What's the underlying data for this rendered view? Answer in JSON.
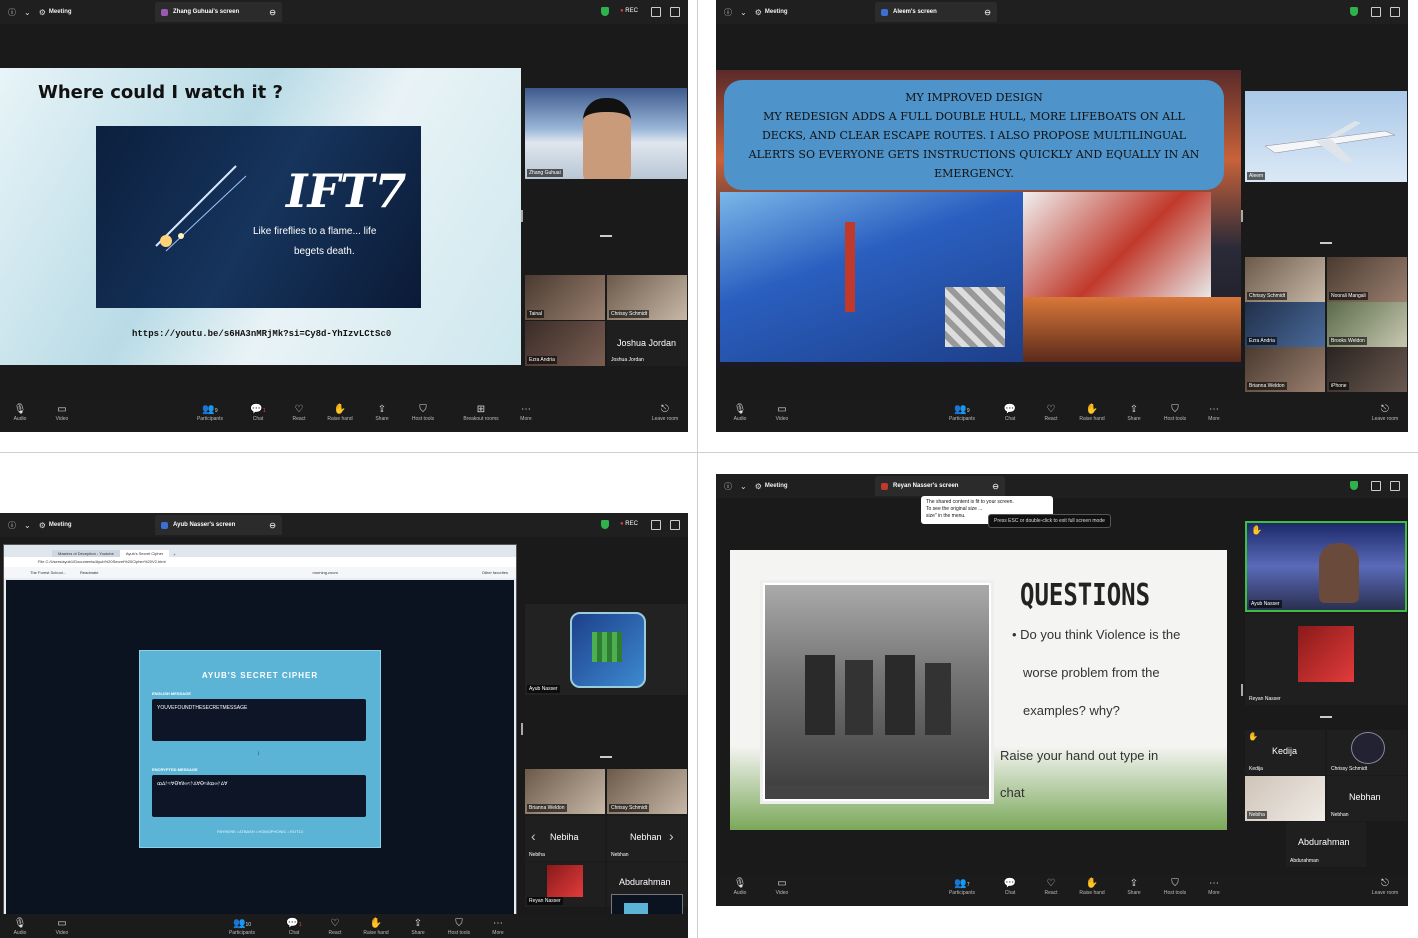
{
  "panels": {
    "p1": {
      "meeting": "Meeting",
      "tab": "Zhang Guhuai's screen",
      "rec": "REC",
      "slide_title": "Where could I watch it ?",
      "movie_title": "IFT7",
      "tagline_1": "Like fireflies to a flame... life",
      "tagline_2": "begets death.",
      "url": "https://youtu.be/s6HA3nMRjMk?si=Cy8d-YhIzvLCtSc0",
      "tiles": [
        "Zhang Guhuai",
        "Tainal",
        "Chrissy Schmidt",
        "Ezra Andria",
        "Joshua Jordan"
      ],
      "joshua_big": "Joshua Jordan",
      "participants_count": "9",
      "chat_badge": "1",
      "toolbar": [
        "Audio",
        "Video",
        "Participants",
        "Chat",
        "React",
        "Raise hand",
        "Share",
        "Host tools",
        "Breakout rooms",
        "More",
        "Leave room"
      ]
    },
    "p2": {
      "meeting": "Meeting",
      "tab": "Aleem's screen",
      "slide_line_1": "MY IMPROVED DESIGN",
      "slide_line_2": "MY REDESIGN ADDS A FULL DOUBLE HULL, MORE LIFEBOATS ON ALL",
      "slide_line_3": "DECKS, AND CLEAR ESCAPE ROUTES. I ALSO PROPOSE MULTILINGUAL",
      "slide_line_4": "ALERTS SO EVERYONE GETS INSTRUCTIONS QUICKLY AND EQUALLY IN AN",
      "slide_line_5": "EMERGENCY.",
      "tiles": [
        "Aleem",
        "Chrissy Schmidt",
        "Noorali Mangali",
        "Ezra Andria",
        "Brooks Weldon",
        "Brianna Weldon",
        "iPhone"
      ],
      "participants_count": "9",
      "toolbar": [
        "Audio",
        "Video",
        "Participants",
        "Chat",
        "React",
        "Raise hand",
        "Share",
        "Host tools",
        "More",
        "Leave room"
      ]
    },
    "p3": {
      "meeting": "Meeting",
      "tab": "Ayub Nasser's screen",
      "rec": "REC",
      "browser_tab_1": "Masters of Deception - Youtube",
      "browser_tab_2": "Ayub's Secret Cipher",
      "address": "File  C:/Users/ayub1/Documents/Ayub%20Secret%20Cipher%20V2.html",
      "bookmark_1": "The Forest School...",
      "bookmark_2": "Readmate",
      "bookmark_3": "morning.zoom",
      "bookmark_4": "Other favorites",
      "cipher_title": "AYUB'S SECRET CIPHER",
      "english_label": "ENGLISH MESSAGE",
      "english_value": "YOUVEFOUNDTHESECRETMESSAGE",
      "encrypted_label": "ENCRYPTED MESSAGE",
      "encrypted_value": "ꝏ∆ᚫ≈ⱯꝊⱯ∂∞≈ᚫ∆ⱯꝊ≈∂ꝏ∞ᚫ∆Ɐ",
      "footer": "PAYHERE • ATBASH • HOMOPHONIC • ROT13",
      "tiles": [
        "Ayub Nasser",
        "Brianna Weldon",
        "Chrissy Schmidt",
        "Nebiha",
        "Nebhan",
        "Reyan Nasser",
        "Abdurahman"
      ],
      "participants_count": "10",
      "chat_badge": "1",
      "toolbar": [
        "Audio",
        "Video",
        "Participants",
        "Chat",
        "React",
        "Raise hand",
        "Share",
        "Host tools",
        "More"
      ]
    },
    "p4": {
      "meeting": "Meeting",
      "tab": "Reyan Nasser's screen",
      "tooltip_1": "The shared content is fit to your screen.",
      "tooltip_2": "To see the original size ...",
      "tooltip_3": "size\" in the menu.",
      "esc_hint": "Press ESC or double-click to exit full screen mode",
      "q_title": "QUESTIONS",
      "q_bullet_1": "• Do you think Violence is the",
      "q_bullet_2": "worse problem from the",
      "q_bullet_3": "examples? why?",
      "q_tail_1": "Raise your hand out type in",
      "q_tail_2": "chat",
      "tiles": [
        "Ayub Nasser",
        "Reyan Nasser",
        "Kedija",
        "Chrissy Schmidt",
        "Nebiha",
        "Nebhan",
        "Abdurahman"
      ],
      "kedija_big": "Kedija",
      "nebhan_big": "Nebhan",
      "abdurahman_big": "Abdurahman",
      "participants_count": "7",
      "toolbar": [
        "Audio",
        "Video",
        "Participants",
        "Chat",
        "React",
        "Raise hand",
        "Share",
        "Host tools",
        "More",
        "Leave room"
      ]
    }
  },
  "colors": {
    "zoom_dark": "#1a1a1a",
    "shield_green": "#2fb24b",
    "rec_red": "#e23b3b",
    "cipher_blue": "#5bb4d6",
    "slide_blue_box": "#4e93c9"
  }
}
